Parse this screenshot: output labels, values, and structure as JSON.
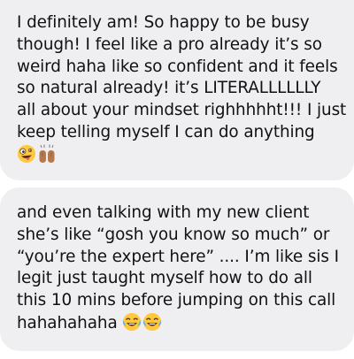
{
  "messages": [
    {
      "lines": [
        "I definitely am! So happy to be busy",
        "though! I feel like a pro already it’s so",
        "weird haha like so confident and it feels",
        "so natural already! it’s LITERALLLLLLY",
        "all about your mindset righhhhht!!! I just",
        "keep telling myself I can do anything"
      ],
      "emojis": [
        "zany-face-emoji",
        "raising-hands-emoji"
      ]
    },
    {
      "lines": [
        "and even talking with my new client",
        "she’s like “gosh you know so much” or",
        "“you’re the expert here” .... I’m like sis I",
        "legit just taught myself how to do all",
        "this 10 mins before jumping on this call"
      ],
      "last_line_text": "hahahahaha",
      "emojis": [
        "tears-of-joy-emoji",
        "tears-of-joy-emoji"
      ]
    }
  ],
  "colors": {
    "bubble_background": "#efeff1",
    "text": "#111111",
    "emoji_yellow": "#ffc83d",
    "emoji_tear_blue": "#5bb8f0",
    "skin_tone": "#b5794d"
  }
}
